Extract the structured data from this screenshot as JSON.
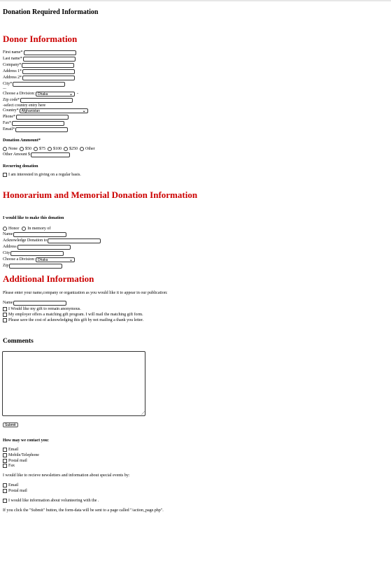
{
  "page_title": "Donation Required Information",
  "donor": {
    "heading": "Donor Information",
    "first_name": "First name*",
    "last_name": "Last name*",
    "company": "Company*",
    "address1": "Address 1*",
    "address2": "Address 2*",
    "city": "City*",
    "ellipsis": "---",
    "division_label": "Choose a Division:",
    "division_value": "Dhaka",
    "division_suffix": "-",
    "zip": "Zip code*",
    "select_country_note": "-select country entry here",
    "country": "Country*",
    "country_value": "Afghanistan",
    "phone": "Phone*",
    "fax": "Fax*",
    "email": "Email*"
  },
  "donation": {
    "heading": "Donation Ammount*",
    "options": [
      "None",
      "$50",
      "$75",
      "$100",
      "$250",
      "Other"
    ],
    "other_amount": "Other Amount $"
  },
  "recurring": {
    "heading": "Recurring donation",
    "checkbox": "I am interested in giving on a regular basis."
  },
  "honorarium": {
    "heading": "Honorarium and Memorial Donation Information",
    "sub": "I would like to make this donation",
    "opt_honor": "Honor",
    "opt_memory": "In memory of",
    "name": "Name",
    "acknowledge": "Acknowledge Donation to",
    "address": "Address",
    "city": "City",
    "division_label": "Choose a Division:",
    "division_value": "Dhaka",
    "zip": "Zip"
  },
  "additional": {
    "heading": "Additional Information",
    "note": "Please enter your name,company or organization as you would like it to appear in our publication:",
    "name": "Name",
    "checks": [
      "I Would like my gift to remain anonymous.",
      "My employer offers a matching gift program. I will mail the matching gift form.",
      "Please save the cost of acknowledging this gift by not mailing a thank you letter."
    ]
  },
  "comments": {
    "heading": "Comments"
  },
  "submit_label": "Submit",
  "contact": {
    "heading": "How may we contact you:",
    "options": [
      "Email",
      "Mobile/Telephone",
      "Postal mail",
      "Fax"
    ]
  },
  "newsletter": {
    "note": "I would like to recieve newsletters and information about special events by:",
    "options": [
      "Email",
      "Postal mail"
    ]
  },
  "volunteer": "I would like information about volunteering with the .",
  "footer_note": "If you click the \"Submit\" button, the form-data will be sent to a page called \"/action_page.php\"."
}
